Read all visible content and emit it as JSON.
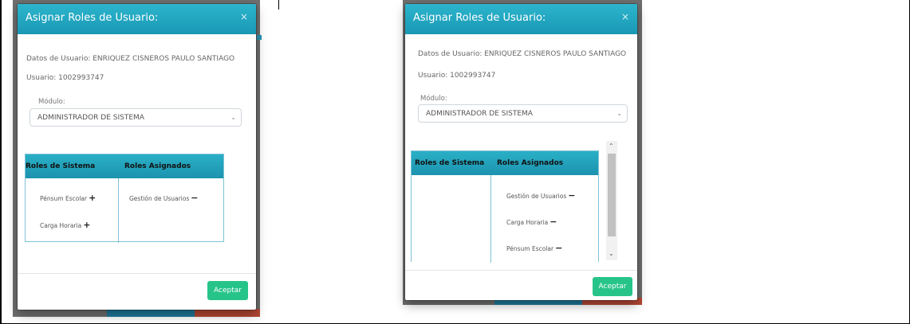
{
  "left_modal": {
    "title": "Asignar Roles de Usuario:",
    "close_symbol": "×",
    "user_data_label": "Datos de Usuario: ENRIQUEZ CISNEROS PAULO SANTIAGO",
    "username_label": "Usuario: 1002993747",
    "module_label": "Módulo:",
    "module_value": "ADMINISTRADOR DE SISTEMA",
    "table": {
      "col_system": "Roles de Sistema",
      "col_assigned": "Roles Asignados",
      "system_roles": [
        "Pénsum Escolar",
        "Carga Horaria"
      ],
      "assigned_roles": [
        "Gestión de Usuarios"
      ]
    },
    "accept_label": "Aceptar",
    "add_sign": "+",
    "remove_sign": "−"
  },
  "right_modal": {
    "title": "Asignar Roles de Usuario:",
    "close_symbol": "×",
    "user_data_label": "Datos de Usuario: ENRIQUEZ CISNEROS PAULO SANTIAGO",
    "username_label": "Usuario: 1002993747",
    "module_label": "Módulo:",
    "module_value": "ADMINISTRADOR DE SISTEMA",
    "table": {
      "col_system": "Roles de Sistema",
      "col_assigned": "Roles Asignados",
      "system_roles": [],
      "assigned_roles": [
        "Gestión de Usuarios",
        "Carga Horaria",
        "Pénsum Escolar"
      ]
    },
    "accept_label": "Aceptar",
    "remove_sign": "−"
  },
  "colors": {
    "header_teal": "#1a98b5",
    "accept_green": "#27c48a"
  }
}
